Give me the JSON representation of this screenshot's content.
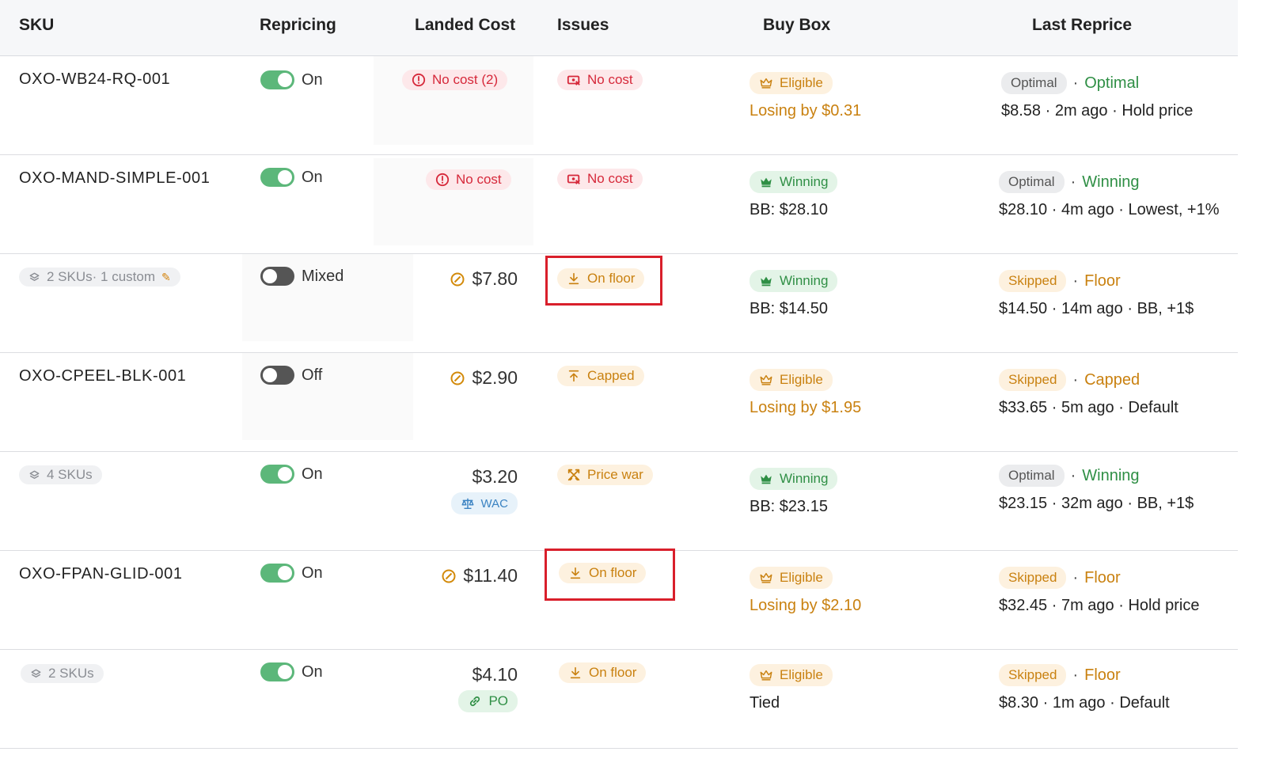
{
  "columns": {
    "sku": "SKU",
    "repricing": "Repricing",
    "landed_cost": "Landed Cost",
    "issues": "Issues",
    "buy_box": "Buy Box",
    "last_reprice": "Last Reprice"
  },
  "colors": {
    "toggle_on": "#5cb77a",
    "toggle_off": "#555555",
    "error_red": "#d6283a",
    "warning_amber": "#c98110",
    "success_green": "#2f8f45",
    "highlight_red": "#d91f2b"
  },
  "rows": [
    {
      "sku": "OXO-WB24-RQ-001",
      "repricing": "On",
      "cost_badge": "No cost (2)",
      "issue": "No cost",
      "bb_badge": "Eligible",
      "bb_detail": "Losing by $0.31",
      "lp_badge": "Optimal",
      "lp_status": "Optimal",
      "lp_price": "$8.58",
      "lp_time": "2m ago",
      "lp_rule": "Hold price"
    },
    {
      "sku": "OXO-MAND-SIMPLE-001",
      "repricing": "On",
      "cost_badge": "No cost",
      "issue": "No cost",
      "bb_badge": "Winning",
      "bb_detail": "BB: $28.10",
      "lp_badge": "Optimal",
      "lp_status": "Winning",
      "lp_price": "$28.10",
      "lp_time": "4m ago",
      "lp_rule": "Lowest, +1%"
    },
    {
      "sku_group": "2 SKUs· 1 custom",
      "repricing": "Mixed",
      "cost": "$7.80",
      "issue": "On floor",
      "bb_badge": "Winning",
      "bb_detail": "BB: $14.50",
      "lp_badge": "Skipped",
      "lp_status": "Floor",
      "lp_price": "$14.50",
      "lp_time": "14m ago",
      "lp_rule": "BB, +1$"
    },
    {
      "sku": "OXO-CPEEL-BLK-001",
      "repricing": "Off",
      "cost": "$2.90",
      "issue": "Capped",
      "bb_badge": "Eligible",
      "bb_detail": "Losing by $1.95",
      "lp_badge": "Skipped",
      "lp_status": "Capped",
      "lp_price": "$33.65",
      "lp_time": "5m ago",
      "lp_rule": "Default"
    },
    {
      "sku_group": "4 SKUs",
      "repricing": "On",
      "cost": "$3.20",
      "cost_tag": "WAC",
      "issue": "Price war",
      "bb_badge": "Winning",
      "bb_detail": "BB: $23.15",
      "lp_badge": "Optimal",
      "lp_status": "Winning",
      "lp_price": "$23.15",
      "lp_time": "32m ago",
      "lp_rule": "BB, +1$"
    },
    {
      "sku": "OXO-FPAN-GLID-001",
      "repricing": "On",
      "cost": "$11.40",
      "issue": "On floor",
      "bb_badge": "Eligible",
      "bb_detail": "Losing by $2.10",
      "lp_badge": "Skipped",
      "lp_status": "Floor",
      "lp_price": "$32.45",
      "lp_time": "7m ago",
      "lp_rule": "Hold price"
    },
    {
      "sku_group": "2 SKUs",
      "repricing": "On",
      "cost": "$4.10",
      "cost_tag": "PO",
      "issue": "On floor",
      "bb_badge": "Eligible",
      "bb_detail": "Tied",
      "lp_badge": "Skipped",
      "lp_status": "Floor",
      "lp_price": "$8.30",
      "lp_time": "1m ago",
      "lp_rule": "Default"
    }
  ]
}
